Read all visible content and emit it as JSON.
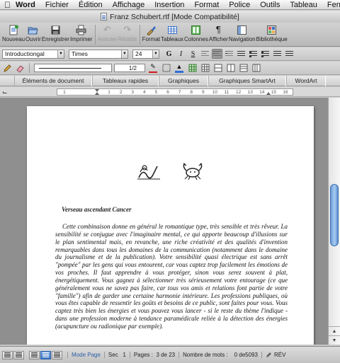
{
  "menubar": {
    "app": "Word",
    "items": [
      "Fichier",
      "Édition",
      "Affichage",
      "Insertion",
      "Format",
      "Police",
      "Outils",
      "Tableau",
      "Fenêtre"
    ]
  },
  "window": {
    "title": "Franz Schubert.rtf [Mode Compatibilité]"
  },
  "toolbar": {
    "buttons": [
      {
        "label": "Nouveau",
        "icon": "new-document-icon"
      },
      {
        "label": "Ouvrir",
        "icon": "folder-open-icon"
      },
      {
        "label": "Enregistrer",
        "icon": "save-disk-icon"
      },
      {
        "label": "Imprimer",
        "icon": "printer-icon"
      },
      {
        "label": "Annuler",
        "icon": "undo-icon"
      },
      {
        "label": "Rétablir",
        "icon": "redo-icon"
      },
      {
        "label": "Format",
        "icon": "format-brush-icon"
      },
      {
        "label": "Tableaux",
        "icon": "table-icon"
      },
      {
        "label": "Colonnes",
        "icon": "columns-icon"
      },
      {
        "label": "Afficher",
        "icon": "pilcrow-icon"
      },
      {
        "label": "Navigation",
        "icon": "navigation-pane-icon"
      },
      {
        "label": "Bibliothèque",
        "icon": "toolbox-icon"
      }
    ]
  },
  "formatting": {
    "style": "Introductiongal",
    "font": "Times",
    "size": "24",
    "italic": "I",
    "grow": "G",
    "underline": "S"
  },
  "drawing": {
    "line_weight": "1/2"
  },
  "ribbon": {
    "tabs": [
      "Éléments de document",
      "Tableaux rapides",
      "Graphiques",
      "Graphiques SmartArt",
      "WordArt"
    ]
  },
  "ruler": {
    "numbers": [
      "1",
      "1",
      "2",
      "3",
      "4",
      "5",
      "6",
      "7",
      "8",
      "9",
      "10",
      "11",
      "12",
      "13",
      "14",
      "15",
      "16"
    ]
  },
  "document": {
    "symbols": [
      "♒",
      "♋"
    ],
    "heading": "Verseau ascendant Cancer",
    "paragraph": "Cette combinaison donne en général le romantique type, très sensible et très rêveur. La sensibilité se conjugue avec l'imaginaire mental, ce qui apporte beaucoup d'illusions sur le plan sentimental mais, en revanche, une riche créativité et des qualités d'invention remarquables dans tous les domaines de la communication (notamment dans le domaine du journalisme et de la publication). Votre sensibilité quasi électrique est sans arrêt \"pompée\" par les gens qui vous entourent, car vous captez trop facilement les émotions de vos proches. Il faut apprendre à vous protéger, sinon vous serez souvent à plat, énergétiquement. Vous gagnez à sélectionner très sérieusement votre entourage (ce que généralement vous ne savez pas faire, car tous vos amis et relations font partie de votre \"famille\") afin de garder une certaine harmonie intérieure. Les professions publiques, où vous êtes capable de ressentir les goûts et besoins de ce public, sont faites pour vous. Vous captez très bien les énergies et vous pouvez vous lancer - si le reste du thème l'indique - dans une profession moderne à tendance paramédicale reliée à la détection des énergies (acupuncture ou radionique par exemple)."
  },
  "status": {
    "mode": "Mode Page",
    "sec_label": "Sec",
    "sec_value": "1",
    "pages_label": "Pages :",
    "pages_value": "3 de 23",
    "words_label": "Nombre de mots :",
    "words_value": "0 de5093",
    "rev": "RÉV"
  },
  "colors": {
    "accent": "#3d76c6",
    "font_color_bar": "#d11a1a",
    "highlight_bar": "#f5e430",
    "fill_bar": "#2f6fd6"
  }
}
